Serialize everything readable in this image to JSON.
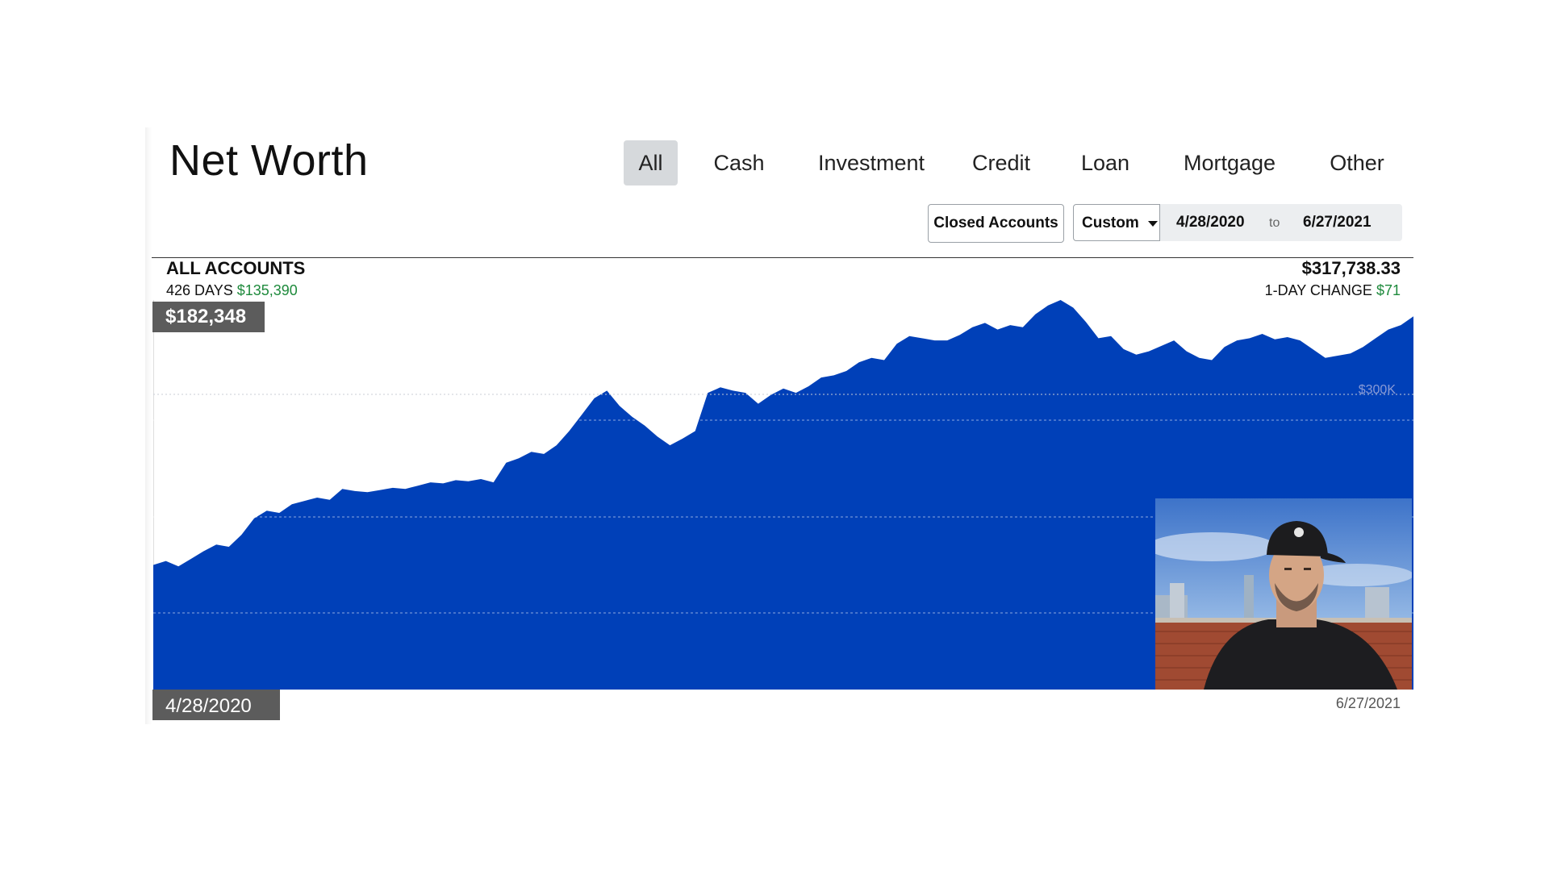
{
  "page": {
    "title": "Net Worth"
  },
  "tabs": [
    {
      "label": "All",
      "active": true
    },
    {
      "label": "Cash",
      "active": false
    },
    {
      "label": "Investment",
      "active": false
    },
    {
      "label": "Credit",
      "active": false
    },
    {
      "label": "Loan",
      "active": false
    },
    {
      "label": "Mortgage",
      "active": false
    },
    {
      "label": "Other",
      "active": false
    }
  ],
  "controls": {
    "closed_accounts_label": "Closed Accounts",
    "range_label": "Custom",
    "range_caret_icon": "caret-down-icon",
    "date_start": "4/28/2020",
    "date_to": "to",
    "date_end": "6/27/2021"
  },
  "summary": {
    "accounts_label": "ALL ACCOUNTS",
    "days_label": "426 DAYS",
    "days_change": "$135,390",
    "total_value": "$317,738.33",
    "change_label": "1-DAY CHANGE",
    "change_value": "$71"
  },
  "chart_tags": {
    "start_value": "$182,348",
    "start_date": "4/28/2020",
    "end_date": "6/27/2021",
    "gridline_label": "$300K"
  },
  "colors": {
    "area": "#0040b8",
    "positive": "#1e8a3c",
    "tag_bg": "#5c5c5c",
    "active_tab": "#d6d9dc"
  },
  "webcam": {
    "icon": "webcam-person-image"
  },
  "chart_data": {
    "type": "area",
    "x_start": "4/28/2020",
    "x_end": "6/27/2021",
    "ylim": [
      0,
      360000
    ],
    "gridlines": [
      100000,
      200000,
      300000
    ],
    "y_label_shown": "$300K",
    "values": [
      182348,
      186000,
      181000,
      188000,
      195000,
      201000,
      199000,
      210000,
      225000,
      232000,
      230000,
      238000,
      241000,
      244000,
      242000,
      252000,
      250000,
      249000,
      251000,
      253000,
      252000,
      255000,
      258000,
      257000,
      260000,
      259000,
      261000,
      258000,
      276000,
      280000,
      286000,
      284000,
      292000,
      305000,
      320000,
      335000,
      342000,
      328000,
      318000,
      310000,
      300000,
      292000,
      298000,
      305000,
      340000,
      345000,
      342000,
      340000,
      330000,
      338000,
      344000,
      340000,
      346000,
      354000,
      356000,
      360000,
      368000,
      372000,
      370000,
      385000,
      392000,
      390000,
      388000,
      388000,
      393000,
      400000,
      404000,
      398000,
      402000,
      400000,
      412000,
      420000,
      425000,
      418000,
      405000,
      390000,
      392000,
      380000,
      375000,
      378000,
      383000,
      388000,
      378000,
      372000,
      370000,
      382000,
      388000,
      390000,
      394000,
      389000,
      391000,
      388000,
      380000,
      372000,
      374000,
      376000,
      382000,
      390000,
      398000,
      402000,
      410000
    ]
  }
}
